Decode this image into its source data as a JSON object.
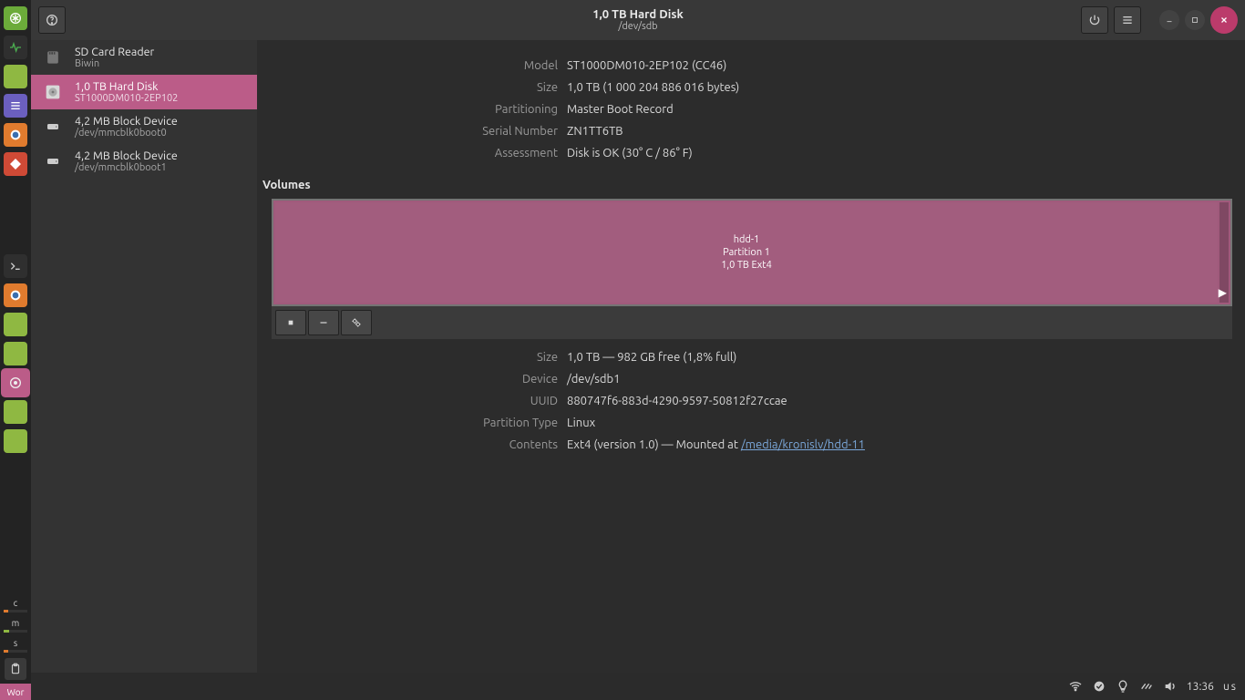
{
  "window": {
    "title": "1,0 TB Hard Disk",
    "subtitle": "/dev/sdb"
  },
  "sidebar": {
    "items": [
      {
        "title": "SD Card Reader",
        "subtitle": "Biwin",
        "icon": "sd"
      },
      {
        "title": "1,0 TB Hard Disk",
        "subtitle": "ST1000DM010-2EP102",
        "icon": "hdd",
        "selected": true
      },
      {
        "title": "4,2 MB Block Device",
        "subtitle": "/dev/mmcblk0boot0",
        "icon": "drive"
      },
      {
        "title": "4,2 MB Block Device",
        "subtitle": "/dev/mmcblk0boot1",
        "icon": "drive"
      }
    ]
  },
  "disk": {
    "model_label": "Model",
    "model": "ST1000DM010-2EP102 (CC46)",
    "size_label": "Size",
    "size": "1,0 TB (1 000 204 886 016 bytes)",
    "part_label": "Partitioning",
    "partitioning": "Master Boot Record",
    "serial_label": "Serial Number",
    "serial": "ZN1TT6TB",
    "assess_label": "Assessment",
    "assessment": "Disk is OK (30° C / 86° F)"
  },
  "volumes": {
    "heading": "Volumes",
    "partition": {
      "line1": "hdd-1",
      "line2": "Partition 1",
      "line3": "1,0 TB Ext4"
    }
  },
  "partition": {
    "size_label": "Size",
    "size": "1,0 TB — 982 GB free (1,8% full)",
    "device_label": "Device",
    "device": "/dev/sdb1",
    "uuid_label": "UUID",
    "uuid": "880747f6-883d-4290-9597-50812f27ccae",
    "type_label": "Partition Type",
    "type": "Linux",
    "contents_label": "Contents",
    "contents_prefix": "Ext4 (version 1.0) — Mounted at ",
    "contents_link": "/media/kronislv/hdd-11"
  },
  "taskbar": {
    "clock": "13:36",
    "layout": "us"
  },
  "dock": {
    "monitors": [
      {
        "label": "c"
      },
      {
        "label": "m"
      },
      {
        "label": "s"
      }
    ],
    "workspace": "Wor"
  }
}
